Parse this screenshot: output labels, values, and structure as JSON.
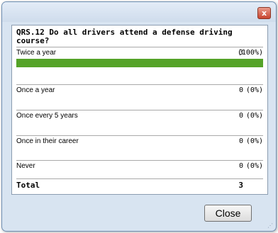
{
  "dialog": {
    "close_icon": "close-x-icon",
    "close_glyph": "x",
    "close_button": "Close"
  },
  "question": "QRS.12 Do all drivers attend a defense driving course?",
  "answers": [
    {
      "label": "Twice a year",
      "count": "3",
      "percent": "(100%)",
      "fraction": 1.0
    },
    {
      "label": "Once a year",
      "count": "0",
      "percent": "(0%)",
      "fraction": 0
    },
    {
      "label": "Once every 5 years",
      "count": "0",
      "percent": "(0%)",
      "fraction": 0
    },
    {
      "label": "Once in their career",
      "count": "0",
      "percent": "(0%)",
      "fraction": 0
    },
    {
      "label": "Never",
      "count": "0",
      "percent": "(0%)",
      "fraction": 0
    }
  ],
  "total": {
    "label": "Total",
    "count": "3"
  },
  "colors": {
    "bar": "#55a328",
    "close_x": "#c8442e"
  }
}
